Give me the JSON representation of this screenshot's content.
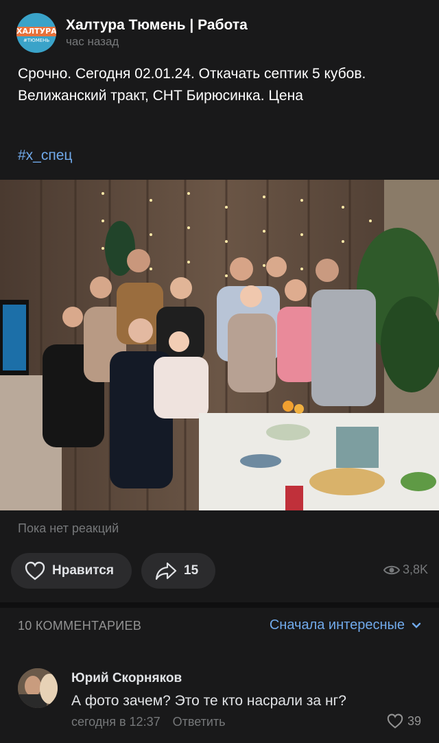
{
  "post": {
    "group_name": "Халтура Тюмень | Работа",
    "time": "час назад",
    "logo_text": "ХАЛТУРА",
    "logo_subtext": "#ТЮМЕНЬ",
    "text": "Срочно. Сегодня 02.01.24. Откачать септик 5 кубов. Велижанский тракт, СНТ Бирюсинка. Цена",
    "hashtag": "#х_спец"
  },
  "footer": {
    "no_reactions": "Пока нет реакций",
    "like_label": "Нравится",
    "share_count": "15",
    "views": "3,8K"
  },
  "comments": {
    "count_label": "10 КОММЕНТАРИЕВ",
    "sort_label": "Сначала интересные",
    "items": [
      {
        "author": "Юрий Скорняков",
        "text": "А фото зачем? Это те кто насрали за нг?",
        "time": "сегодня в 12:37",
        "reply_label": "Ответить",
        "likes": "39"
      }
    ]
  },
  "colors": {
    "background": "#19191a",
    "accent": "#71aaeb",
    "secondary_text": "#76787a"
  }
}
